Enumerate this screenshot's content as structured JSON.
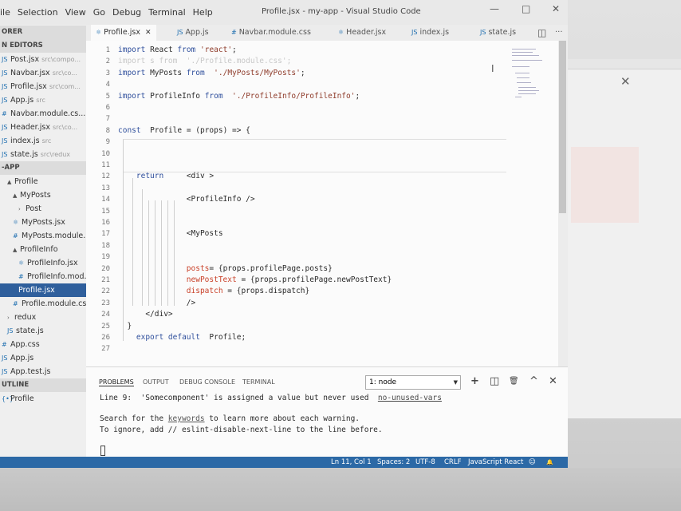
{
  "window": {
    "title": "Profile.jsx - my-app - Visual Studio Code"
  },
  "menu": [
    "ile",
    "Selection",
    "View",
    "Go",
    "Debug",
    "Terminal",
    "Help"
  ],
  "window_controls": {
    "minimize": "—",
    "maximize": "□",
    "close": "✕"
  },
  "sidebar": {
    "rows": [
      {
        "text": "ORER",
        "kind": "section"
      },
      {
        "text": "N EDITORS",
        "kind": "section"
      },
      {
        "icon": "JS",
        "text": "Post.jsx",
        "desc": "src\\compo..."
      },
      {
        "icon": "JS",
        "text": "Navbar.jsx",
        "desc": "src\\co..."
      },
      {
        "icon": "JS",
        "text": "Profile.jsx",
        "desc": "src\\com..."
      },
      {
        "icon": "JS",
        "text": "App.js",
        "desc": "src"
      },
      {
        "icon": "#",
        "text": "Navbar.module.cs..."
      },
      {
        "icon": "JS",
        "text": "Header.jsx",
        "desc": "src\\co..."
      },
      {
        "icon": "JS",
        "text": "index.js",
        "desc": "src"
      },
      {
        "icon": "JS",
        "text": "state.js",
        "desc": "src\\redux"
      },
      {
        "text": "-APP",
        "kind": "section"
      },
      {
        "twisty": "▲",
        "text": "Profile",
        "indent": 1
      },
      {
        "twisty": "▲",
        "text": "MyPosts",
        "indent": 2
      },
      {
        "twisty": "›",
        "text": "Post",
        "indent": 3
      },
      {
        "icon": "⚛",
        "text": "MyPosts.jsx",
        "indent": 2
      },
      {
        "icon": "#",
        "text": "MyPosts.module...",
        "indent": 2
      },
      {
        "twisty": "▲",
        "text": "ProfileInfo",
        "indent": 2
      },
      {
        "icon": "⚛",
        "text": "ProfileInfo.jsx",
        "indent": 3
      },
      {
        "icon": "#",
        "text": "ProfileInfo.mod...",
        "indent": 3
      },
      {
        "text": "Profile.jsx",
        "indent": 3,
        "kind": "selected"
      },
      {
        "icon": "#",
        "text": "Profile.module.css",
        "indent": 2
      },
      {
        "twisty": "›",
        "text": "redux",
        "indent": 1
      },
      {
        "icon": "JS",
        "text": "state.js",
        "indent": 1
      },
      {
        "icon": "#",
        "text": "App.css",
        "indent": 0
      },
      {
        "icon": "JS",
        "text": "App.js",
        "indent": 0
      },
      {
        "icon": "JS",
        "text": "App.test.js",
        "indent": 0
      },
      {
        "text": "UTLINE",
        "kind": "section"
      },
      {
        "icon": "{•}",
        "text": "Profile",
        "indent": 0
      }
    ]
  },
  "tabs": [
    {
      "icon": "⚛",
      "label": "Profile.jsx",
      "close": "✕",
      "active": true
    },
    {
      "icon": "JS",
      "label": "App.js"
    },
    {
      "icon": "#",
      "label": "Navbar.module.css"
    },
    {
      "icon": "⚛",
      "label": "Header.jsx"
    },
    {
      "icon": "JS",
      "label": "index.js"
    },
    {
      "icon": "JS",
      "label": "state.js"
    }
  ],
  "editor_actions": {
    "split": "◫",
    "more": "···"
  },
  "editor": {
    "lines": [
      {
        "n": "1",
        "tokens": [
          [
            "kw",
            "import"
          ],
          [
            "",
            "React "
          ],
          [
            "kw",
            "from "
          ],
          [
            "str",
            "'react'"
          ],
          [
            "",
            ";"
          ]
        ]
      },
      {
        "n": "2",
        "tokens": [
          [
            "faded",
            "import s from  './Profile.module.css';"
          ]
        ]
      },
      {
        "n": "3",
        "tokens": [
          [
            "kw",
            "import"
          ],
          [
            "",
            "MyPosts "
          ],
          [
            "kw",
            "from "
          ],
          [
            "str",
            " './MyPosts/MyPosts'"
          ],
          [
            "",
            ";"
          ]
        ]
      },
      {
        "n": "4",
        "tokens": []
      },
      {
        "n": "5",
        "tokens": [
          [
            "kw",
            "import"
          ],
          [
            "",
            "ProfileInfo "
          ],
          [
            "kw",
            "from "
          ],
          [
            "str",
            " './ProfileInfo/ProfileInfo'"
          ],
          [
            "",
            ";"
          ]
        ]
      },
      {
        "n": "6",
        "tokens": []
      },
      {
        "n": "7",
        "tokens": []
      },
      {
        "n": "8",
        "tokens": [
          [
            "kw",
            "const"
          ],
          [
            "",
            " Profile = (props) => {"
          ]
        ]
      },
      {
        "n": "9",
        "tokens": []
      },
      {
        "n": "10",
        "tokens": []
      },
      {
        "n": "11",
        "tokens": []
      },
      {
        "n": "12",
        "tokens": [
          [
            "",
            "    "
          ],
          [
            "kw",
            "return"
          ],
          [
            "",
            "    <div >"
          ]
        ]
      },
      {
        "n": "13",
        "tokens": []
      },
      {
        "n": "14",
        "tokens": [
          [
            "",
            "               <ProfileInfo />"
          ]
        ]
      },
      {
        "n": "15",
        "tokens": []
      },
      {
        "n": "16",
        "tokens": []
      },
      {
        "n": "17",
        "tokens": [
          [
            "",
            "               <MyPosts"
          ]
        ]
      },
      {
        "n": "18",
        "tokens": []
      },
      {
        "n": "19",
        "tokens": []
      },
      {
        "n": "20",
        "tokens": [
          [
            "",
            "               "
          ],
          [
            "attr",
            "posts"
          ],
          [
            "",
            "= {props.profilePage.posts}"
          ]
        ]
      },
      {
        "n": "21",
        "tokens": [
          [
            "",
            "               "
          ],
          [
            "attr",
            "newPostText"
          ],
          [
            "",
            " = {props.profilePage.newPostText}"
          ]
        ]
      },
      {
        "n": "22",
        "tokens": [
          [
            "",
            "               "
          ],
          [
            "attr",
            "dispatch"
          ],
          [
            "",
            " = {props.dispatch}"
          ]
        ]
      },
      {
        "n": "23",
        "tokens": [
          [
            "",
            "               />"
          ]
        ]
      },
      {
        "n": "24",
        "tokens": [
          [
            "",
            "      </div>"
          ]
        ]
      },
      {
        "n": "25",
        "tokens": [
          [
            "",
            "  }"
          ]
        ]
      },
      {
        "n": "26",
        "tokens": [
          [
            "",
            "    "
          ],
          [
            "kw",
            "export default"
          ],
          [
            "",
            " Profile;"
          ]
        ]
      },
      {
        "n": "27",
        "tokens": []
      }
    ]
  },
  "panel": {
    "tabs": [
      "PROBLEMS",
      "OUTPUT",
      "DEBUG CONSOLE",
      "TERMINAL"
    ],
    "terminal_select": "1: node",
    "icons": {
      "add": "+",
      "split": "◫",
      "trash": "🗑",
      "up": "^",
      "close": "✕"
    },
    "problem": {
      "prefix": "Line 9:  'Somecomponent' is assigned a value but never used  ",
      "rule": "no-unused-vars"
    },
    "help_line1_pre": "Search for the ",
    "help_link": "keywords",
    "help_line1_post": " to learn more about each warning.",
    "help_line2": "To ignore, add // eslint-disable-next-line to the line before."
  },
  "statusbar": {
    "position": "Ln 11, Col 1",
    "spaces": "Spaces: 2",
    "encoding": "UTF-8",
    "eol": "CRLF",
    "language": "JavaScript React",
    "feedback_icon": "☺",
    "bell_icon": "🔔"
  },
  "background_window": {
    "close": "✕"
  },
  "colors": {
    "statusbar": "#2c69a6",
    "keyword": "#2f4f9c",
    "string": "#8e3b2a",
    "attribute": "#c9422a",
    "selected": "#2f5f9c"
  }
}
